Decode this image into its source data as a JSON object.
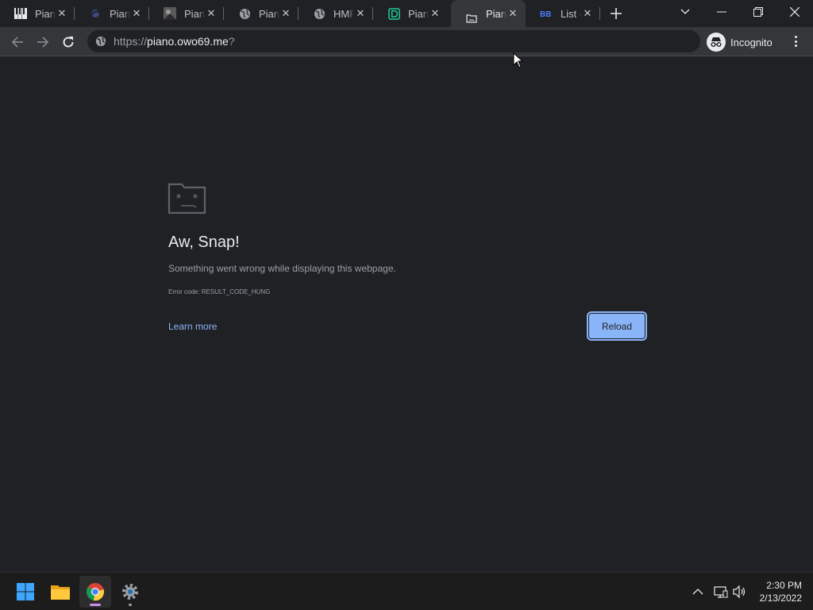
{
  "tabs": [
    {
      "title": "Piano",
      "favicon": "piano-keys-icon",
      "active": false
    },
    {
      "title": "Piano",
      "favicon": "dark-swoosh-icon",
      "active": false
    },
    {
      "title": "Piano",
      "favicon": "photo-icon",
      "active": false
    },
    {
      "title": "Piano",
      "favicon": "globe-icon",
      "active": false
    },
    {
      "title": "HMP",
      "favicon": "globe-icon",
      "active": false
    },
    {
      "title": "Piano",
      "favicon": "green-d-icon",
      "active": false
    },
    {
      "title": "Piano",
      "favicon": "sad-tab-icon",
      "active": true
    },
    {
      "title": "List o",
      "favicon": "bb-icon",
      "active": false
    }
  ],
  "toolbar": {
    "url_scheme": "https://",
    "url_host": "piano.owo69.me",
    "url_rest": "?",
    "incognito_label": "Incognito"
  },
  "error_page": {
    "icon": "sad-folder-icon",
    "title": "Aw, Snap!",
    "message": "Something went wrong while displaying this webpage.",
    "code": "Error code: RESULT_CODE_HUNG",
    "learn_more": "Learn more",
    "reload": "Reload"
  },
  "taskbar": {
    "apps": [
      "windows-start-icon",
      "file-explorer-icon",
      "chrome-icon",
      "settings-icon"
    ],
    "time": "2:30 PM",
    "date": "2/13/2022"
  },
  "colors": {
    "background": "#202124",
    "toolbar": "#35363a",
    "accent": "#8ab4f8",
    "taskbar": "#1c1c1c"
  }
}
